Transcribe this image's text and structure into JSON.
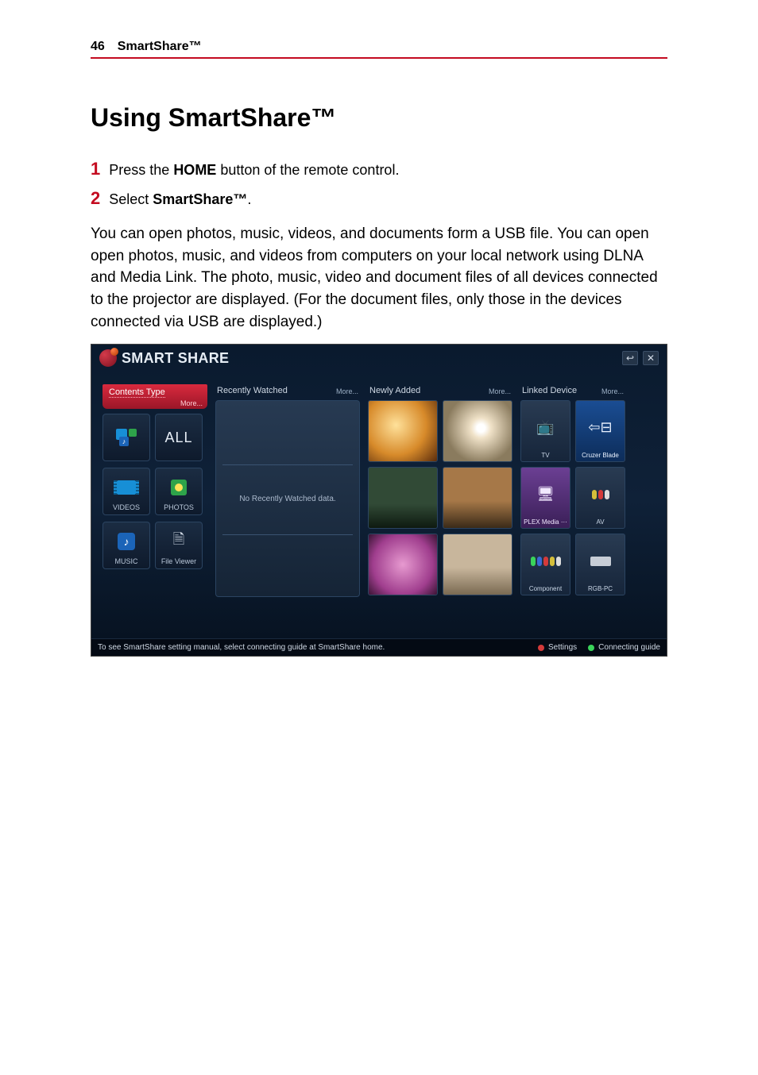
{
  "header": {
    "page_number": "46",
    "section": "SmartShare™"
  },
  "h1": "Using SmartShare™",
  "steps": {
    "s1_num": "1",
    "s1_before": "Press the ",
    "s1_bold": "HOME",
    "s1_after": " button of the remote control.",
    "s2_num": "2",
    "s2_before": "Select ",
    "s2_bold": "SmartShare™",
    "s2_after": "."
  },
  "body_para": "You can open photos, music, videos, and documents form a USB file. You can open open photos, music, and videos from computers on your local network using DLNA and Media Link. The photo, music, video and document files of all devices connected to the projector are displayed. (For the document files, only those in the devices connected via USB are displayed.)",
  "shot": {
    "title": "SMART SHARE",
    "close_glyph": "✕",
    "back_glyph": "↩",
    "contents": {
      "header": "Contents Type",
      "more": "More...",
      "tiles": {
        "all": "ALL",
        "videos": "VIDEOS",
        "photos": "PHOTOS",
        "music": "MUSIC",
        "fileviewer": "File Viewer"
      }
    },
    "recently": {
      "header": "Recently Watched",
      "more": "More...",
      "empty": "No Recently Watched data."
    },
    "newly": {
      "header": "Newly Added",
      "more": "More..."
    },
    "linked": {
      "header": "Linked Device",
      "more": "More...",
      "d1": "TV",
      "d2": "Cruzer Blade",
      "d3": "PLEX Media ···",
      "d4": "AV",
      "d5": "Component",
      "d6": "RGB-PC"
    },
    "footer": {
      "hint": "To see SmartShare setting manual, select connecting guide at SmartShare home.",
      "settings": "Settings",
      "guide": "Connecting guide"
    }
  }
}
